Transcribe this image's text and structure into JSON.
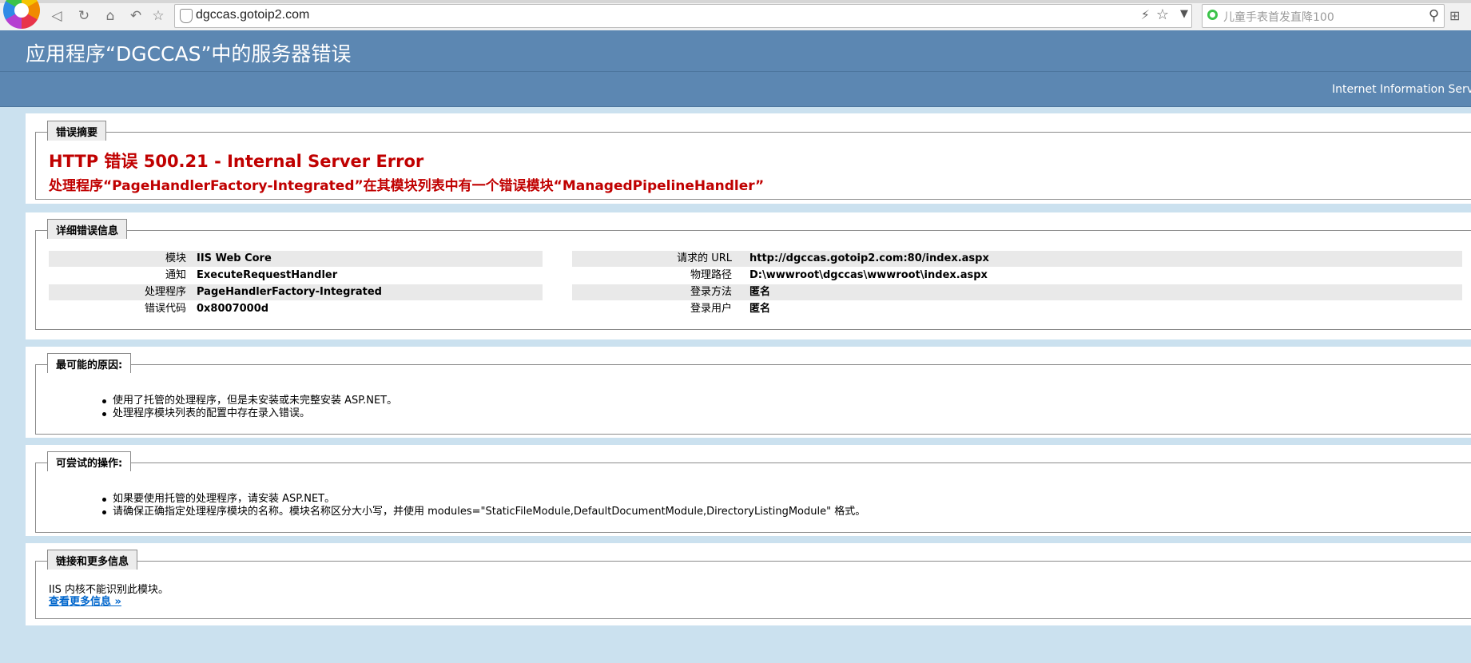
{
  "browser": {
    "url": "dgccas.gotoip2.com",
    "search_placeholder": "儿童手表首发直降100"
  },
  "header": {
    "title": "应用程序“DGCCAS”中的服务器错误",
    "subtitle": "Internet Information Services"
  },
  "summary": {
    "legend": "错误摘要",
    "error_title": "HTTP 错误 500.21 - Internal Server Error",
    "error_message": "处理程序“PageHandlerFactory-Integrated”在其模块列表中有一个错误模块“ManagedPipelineHandler”"
  },
  "details": {
    "legend": "详细错误信息",
    "left": [
      {
        "label": "模块",
        "value": "IIS Web Core"
      },
      {
        "label": "通知",
        "value": "ExecuteRequestHandler"
      },
      {
        "label": "处理程序",
        "value": "PageHandlerFactory-Integrated"
      },
      {
        "label": "错误代码",
        "value": "0x8007000d"
      }
    ],
    "right": [
      {
        "label": "请求的 URL",
        "value": "http://dgccas.gotoip2.com:80/index.aspx"
      },
      {
        "label": "物理路径",
        "value": "D:\\wwwroot\\dgccas\\wwwroot\\index.aspx"
      },
      {
        "label": "登录方法",
        "value": "匿名"
      },
      {
        "label": "登录用户",
        "value": "匿名"
      }
    ]
  },
  "causes": {
    "legend": "最可能的原因:",
    "items": [
      "使用了托管的处理程序，但是未安装或未完整安装 ASP.NET。",
      "处理程序模块列表的配置中存在录入错误。"
    ]
  },
  "actions": {
    "legend": "可尝试的操作:",
    "items": [
      "如果要使用托管的处理程序，请安装 ASP.NET。",
      "请确保正确指定处理程序模块的名称。模块名称区分大小写，并使用 modules=\"StaticFileModule,DefaultDocumentModule,DirectoryListingModule\" 格式。"
    ]
  },
  "links": {
    "legend": "链接和更多信息",
    "text": "IIS 内核不能识别此模块。",
    "link_text": "查看更多信息 »"
  }
}
